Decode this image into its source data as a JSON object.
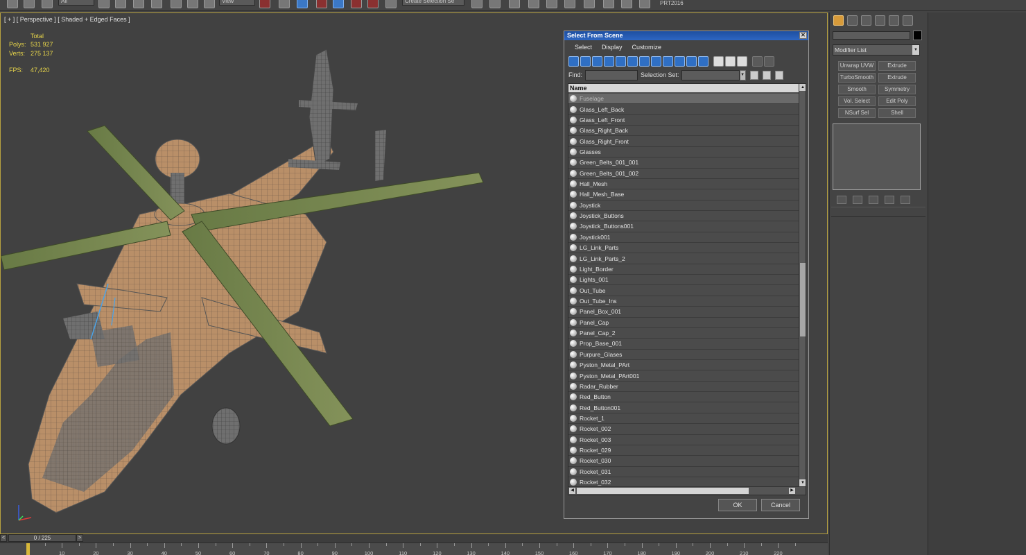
{
  "toolbar": {
    "combo_all": "All",
    "combo_view": "View",
    "combo_selection_set": "Create Selection Se",
    "project_label": "PRT2016"
  },
  "viewport": {
    "label": "[ + ] [ Perspective ] [ Shaded + Edged Faces ]",
    "stats": {
      "total_label": "Total",
      "polys_label": "Polys:",
      "polys_value": "531 927",
      "verts_label": "Verts:",
      "verts_value": "275 137",
      "fps_label": "FPS:",
      "fps_value": "47,420"
    }
  },
  "dialog": {
    "title": "Select From Scene",
    "close_glyph": "✕",
    "menu": [
      "Select",
      "Display",
      "Customize"
    ],
    "find_label": "Find:",
    "selection_set_label": "Selection Set:",
    "column_header": "Name",
    "ok_label": "OK",
    "cancel_label": "Cancel",
    "items": [
      "Fuselage",
      "Glass_Left_Back",
      "Glass_Left_Front",
      "Glass_Right_Back",
      "Glass_Right_Front",
      "Glasses",
      "Green_Belts_001_001",
      "Green_Belts_001_002",
      "Hall_Mesh",
      "Hall_Mesh_Base",
      "Joystick",
      "Joystick_Buttons",
      "Joystick_Buttons001",
      "Joystick001",
      "LG_Link_Parts",
      "LG_Link_Parts_2",
      "Light_Border",
      "Lights_001",
      "Out_Tube",
      "Out_Tube_Ins",
      "Panel_Box_001",
      "Panel_Cap",
      "Panel_Cap_2",
      "Prop_Base_001",
      "Purpure_Glases",
      "Pyston_Metal_PArt",
      "Pyston_Metal_PArt001",
      "Radar_Rubber",
      "Red_Button",
      "Red_Button001",
      "Rocket_1",
      "Rocket_002",
      "Rocket_003",
      "Rocket_029",
      "Rocket_030",
      "Rocket_031",
      "Rocket_032"
    ],
    "selected_index": 0
  },
  "command_panel": {
    "modifier_list_label": "Modifier List",
    "modifier_buttons": [
      "Unwrap UVW",
      "Extrude",
      "TurboSmooth",
      "Extrude",
      "Smooth",
      "Symmetry",
      "Vol. Select",
      "Edit Poly",
      "NSurf Sel",
      "Shell"
    ]
  },
  "timeline": {
    "frame_display": "0 / 225",
    "prev_glyph": "<",
    "next_glyph": ">",
    "ticks": [
      "10",
      "20",
      "30",
      "40",
      "50",
      "60",
      "70",
      "80",
      "90",
      "100",
      "110",
      "120",
      "130",
      "140",
      "150",
      "160",
      "170",
      "180",
      "190",
      "200",
      "210",
      "220"
    ]
  },
  "colors": {
    "accent_blue": "#2d66c3",
    "viewport_border": "#b8a240",
    "stats_yellow": "#e8d64a",
    "active_tab": "#d89b3a"
  }
}
